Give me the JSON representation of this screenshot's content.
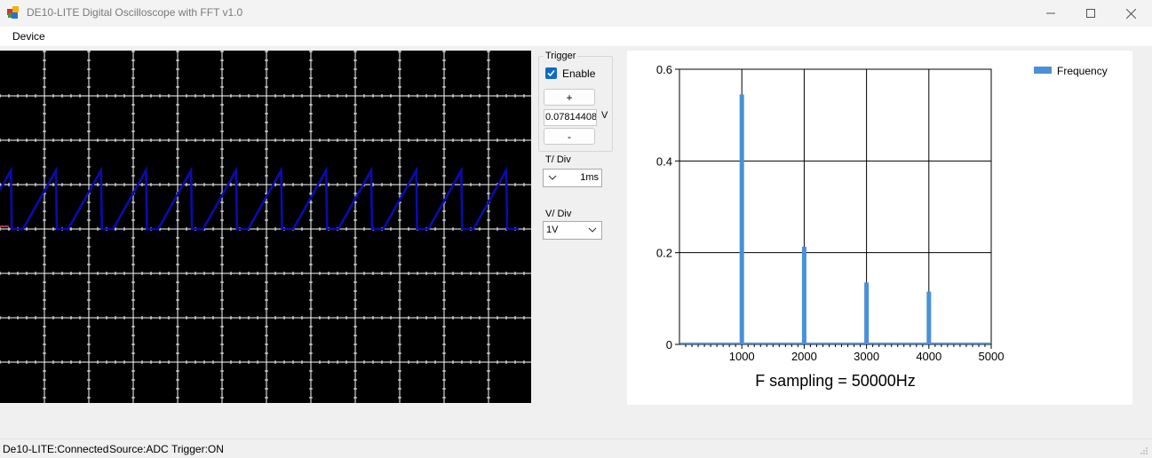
{
  "window": {
    "title": "DE10-LITE Digital Oscilloscope with FFT v1.0"
  },
  "menu": {
    "items": [
      "Device"
    ]
  },
  "trigger": {
    "group_label": "Trigger",
    "enable_label": "Enable",
    "enabled": true,
    "plus_label": "+",
    "minus_label": "-",
    "level_value": "0.07814408",
    "level_unit": "V"
  },
  "timebase": {
    "label": "T/ Div",
    "value": "1ms"
  },
  "voltage": {
    "label": "V/ Div",
    "value": "1V"
  },
  "scope": {
    "trace_color": "#0b0bb0",
    "grid_color": "#ffffff",
    "background": "#000000"
  },
  "chart_data": {
    "type": "bar",
    "title": "",
    "xlabel": "F sampling = 50000Hz",
    "ylabel": "",
    "x_ticks": [
      "1000",
      "2000",
      "3000",
      "4000",
      "5000"
    ],
    "y_ticks": [
      "0",
      "0.2",
      "0.4",
      "0.6"
    ],
    "xlim": [
      0,
      5000
    ],
    "ylim": [
      0,
      0.6
    ],
    "legend": "top-right",
    "series": [
      {
        "name": "Frequency",
        "color": "#4a90d9",
        "x": [
          1000,
          2000,
          3000,
          4000
        ],
        "values": [
          0.545,
          0.213,
          0.135,
          0.115
        ]
      }
    ]
  },
  "status": {
    "items": [
      "De10-LITE:Connected",
      "Source:ADC",
      "Trigger:ON"
    ]
  }
}
